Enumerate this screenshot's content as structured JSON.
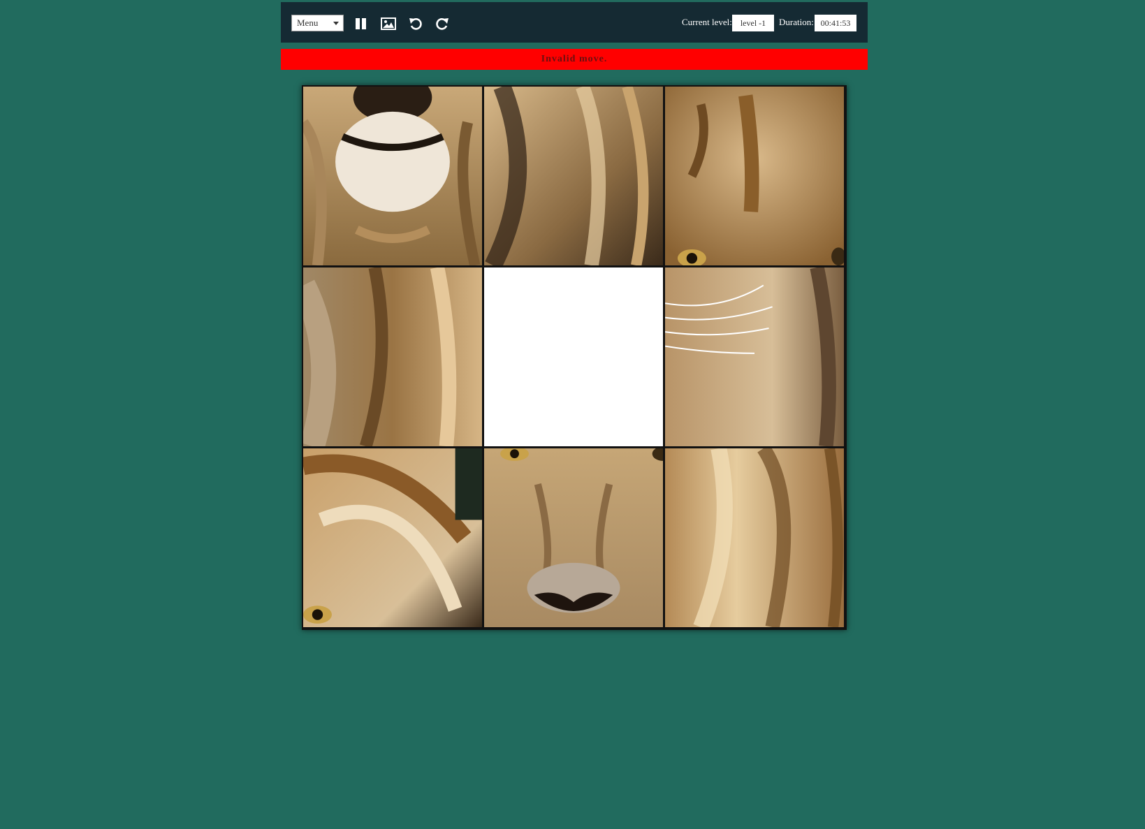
{
  "toolbar": {
    "menu_label": "Menu",
    "level_label": "Current level:",
    "level_value": "level -1",
    "duration_label": "Duration:",
    "duration_value": "00:41:53"
  },
  "message": "Invalid move.",
  "board": {
    "rows": 3,
    "cols": 3,
    "image_subject": "lion face",
    "empty_tile": {
      "row": 2,
      "col": 2
    },
    "tiles": [
      {
        "row": 1,
        "col": 1,
        "depicts": "muzzle and chin"
      },
      {
        "row": 1,
        "col": 2,
        "depicts": "mane"
      },
      {
        "row": 1,
        "col": 3,
        "depicts": "forehead and right eye"
      },
      {
        "row": 2,
        "col": 1,
        "depicts": "mane and cheek"
      },
      {
        "row": 2,
        "col": 3,
        "depicts": "whiskers and mane"
      },
      {
        "row": 3,
        "col": 1,
        "depicts": "mane and left eye"
      },
      {
        "row": 3,
        "col": 2,
        "depicts": "eyes and nose"
      },
      {
        "row": 3,
        "col": 3,
        "depicts": "mane"
      }
    ]
  }
}
